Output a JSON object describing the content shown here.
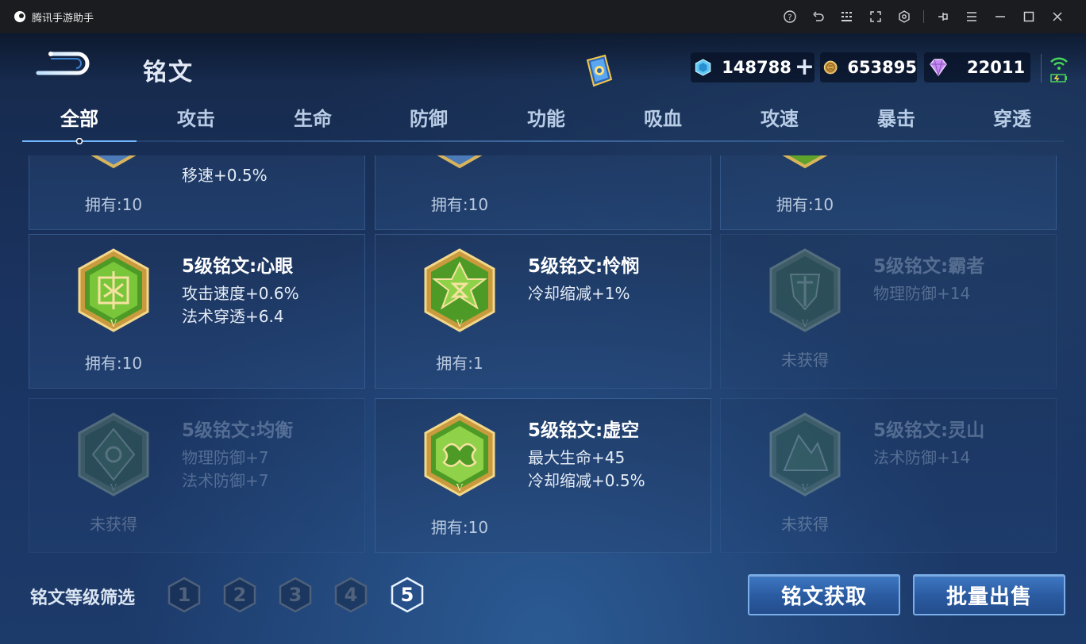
{
  "window": {
    "title": "腾讯手游助手",
    "icons": [
      "help-icon",
      "undo-icon",
      "keyboard-icon",
      "fullscreen-icon",
      "settings-cube-icon",
      "pin-icon",
      "menu-icon",
      "minimize-icon",
      "maximize-icon",
      "close-icon"
    ]
  },
  "header": {
    "title": "铭文",
    "currency": {
      "diamond": "148788",
      "gold": "653895",
      "gem": "22011"
    }
  },
  "tabs": [
    "全部",
    "攻击",
    "生命",
    "防御",
    "功能",
    "吸血",
    "攻速",
    "暴击",
    "穿透"
  ],
  "active_tab": "全部",
  "cards_partial": [
    {
      "stat": "移速+0.5%",
      "owned": "拥有:10"
    },
    {
      "owned": "拥有:10"
    },
    {
      "owned": "拥有:10"
    }
  ],
  "cards": [
    {
      "name": "5级铭文:心眼",
      "stats": [
        "攻击速度+0.6%",
        "法术穿透+6.4"
      ],
      "owned": "拥有:10",
      "obtained": true,
      "icon": "xinyan-emblem-icon"
    },
    {
      "name": "5级铭文:怜悯",
      "stats": [
        "冷却缩减+1%"
      ],
      "owned": "拥有:1",
      "obtained": true,
      "icon": "lianmin-emblem-icon"
    },
    {
      "name": "5级铭文:霸者",
      "stats": [
        "物理防御+14"
      ],
      "owned": "未获得",
      "obtained": false,
      "icon": "bazhe-emblem-icon"
    },
    {
      "name": "5级铭文:均衡",
      "stats": [
        "物理防御+7",
        "法术防御+7"
      ],
      "owned": "未获得",
      "obtained": false,
      "icon": "junheng-emblem-icon"
    },
    {
      "name": "5级铭文:虚空",
      "stats": [
        "最大生命+45",
        "冷却缩减+0.5%"
      ],
      "owned": "拥有:10",
      "obtained": true,
      "icon": "xukong-emblem-icon"
    },
    {
      "name": "5级铭文:灵山",
      "stats": [
        "法术防御+14"
      ],
      "owned": "未获得",
      "obtained": false,
      "icon": "lingshan-emblem-icon"
    }
  ],
  "footer": {
    "filter_label": "铭文等级筛选",
    "levels": [
      "1",
      "2",
      "3",
      "4",
      "5"
    ],
    "active_level": "5",
    "acquire_label": "铭文获取",
    "sell_label": "批量出售"
  },
  "colors": {
    "accent": "#79aee8",
    "button": "#2a5aa0",
    "emblem_green": "#5fa32c",
    "emblem_gold": "#d9b45a"
  }
}
